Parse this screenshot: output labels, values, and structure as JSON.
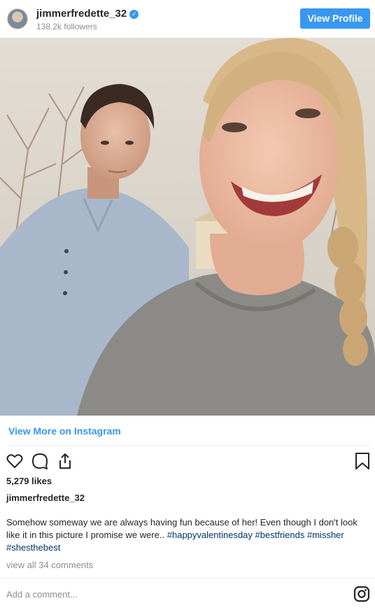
{
  "header": {
    "username": "jimmerfredette_32",
    "followers": "138.2k followers",
    "view_profile_label": "View Profile"
  },
  "post": {
    "view_more_label": "View More on Instagram",
    "likes": "5,279 likes",
    "caption_user": "jimmerfredette_32",
    "caption_text": "Somehow someway we are always having fun because of her! Even though I don't look like it in this picture I promise we were..",
    "hashtags": [
      "#happyvalentinesday",
      "#bestfriends",
      "#missher",
      "#shesthebest"
    ],
    "view_comments": "view all 34 comments",
    "comment_placeholder": "Add a comment..."
  },
  "icons": {
    "verified": "verified-badge-icon",
    "like": "heart-icon",
    "comment": "comment-bubble-icon",
    "share": "share-icon",
    "save": "bookmark-icon",
    "instagram": "instagram-logo-icon"
  },
  "colors": {
    "accent": "#3897f0",
    "hashtag": "#003569",
    "muted": "#8e8e8e"
  }
}
